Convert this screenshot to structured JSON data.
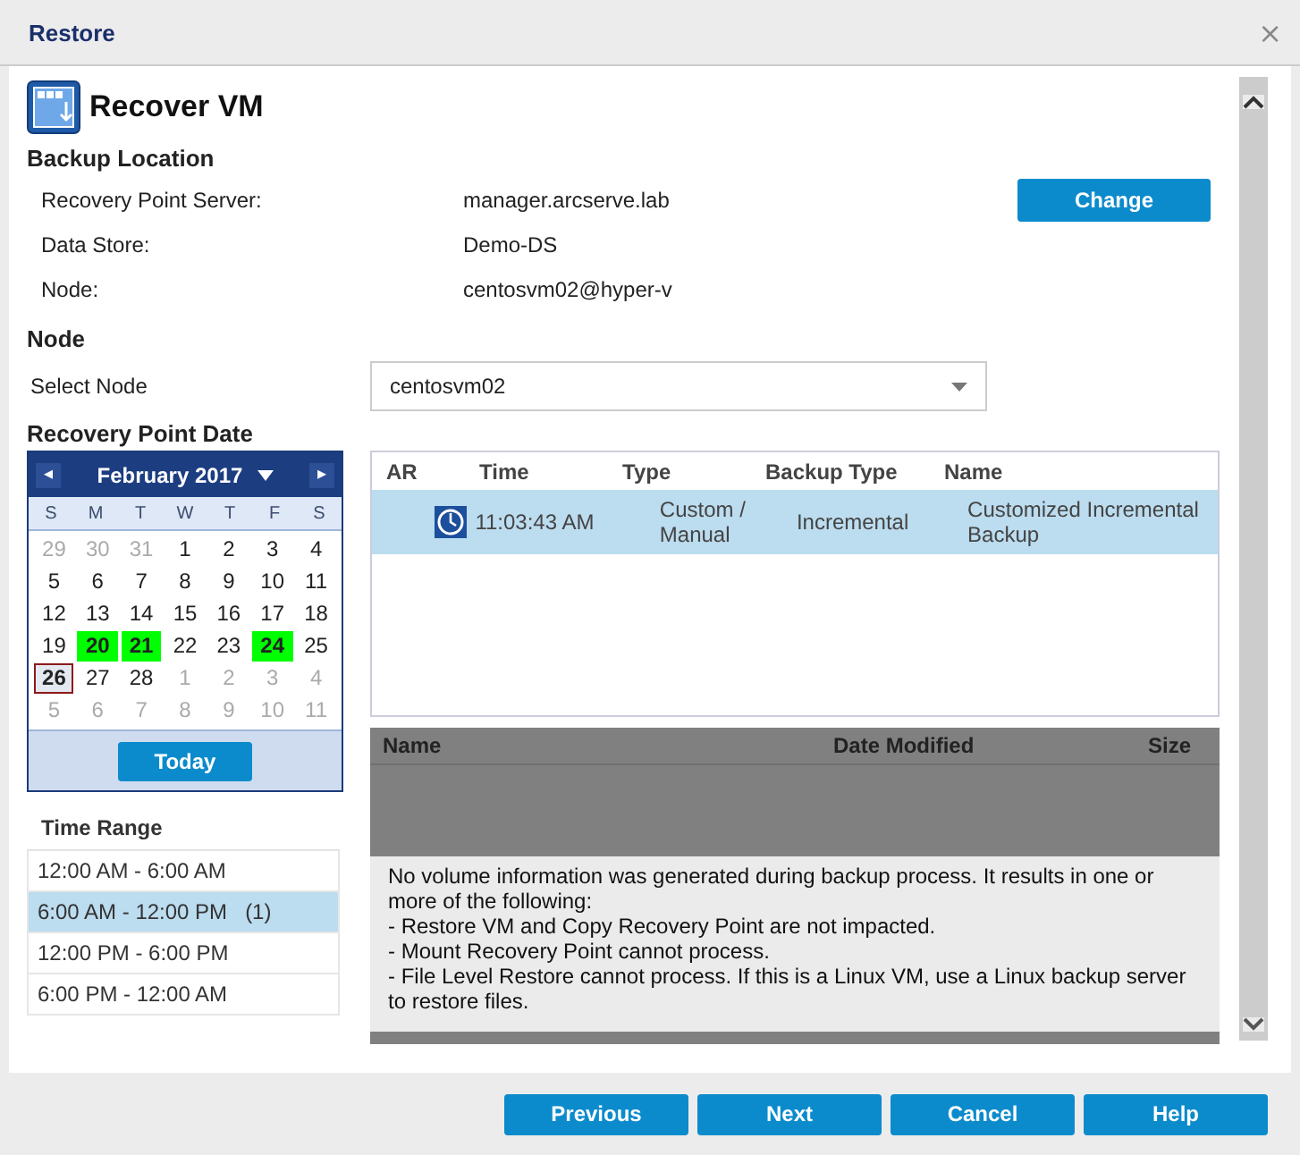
{
  "window": {
    "title": "Restore",
    "close": "×"
  },
  "page_title": "Recover VM",
  "backup_location": {
    "heading": "Backup Location",
    "fields": [
      {
        "label": "Recovery Point Server:",
        "value": "manager.arcserve.lab"
      },
      {
        "label": "Data Store:",
        "value": "Demo-DS"
      },
      {
        "label": "Node:",
        "value": "centosvm02@hyper-v"
      }
    ],
    "change_button": "Change"
  },
  "node": {
    "heading": "Node",
    "label": "Select Node",
    "value": "centosvm02"
  },
  "recovery_point_date": {
    "heading": "Recovery Point Date"
  },
  "calendar": {
    "month": "February 2017",
    "prev": "◂",
    "next": "▸",
    "weekdays": [
      "S",
      "M",
      "T",
      "W",
      "T",
      "F",
      "S"
    ],
    "today_button": "Today",
    "weeks": [
      [
        {
          "day": "29",
          "muted": true,
          "has_backup": false,
          "selected": false
        },
        {
          "day": "30",
          "muted": true,
          "has_backup": false,
          "selected": false
        },
        {
          "day": "31",
          "muted": true,
          "has_backup": false,
          "selected": false
        },
        {
          "day": "1",
          "muted": false,
          "has_backup": false,
          "selected": false
        },
        {
          "day": "2",
          "muted": false,
          "has_backup": false,
          "selected": false
        },
        {
          "day": "3",
          "muted": false,
          "has_backup": false,
          "selected": false
        },
        {
          "day": "4",
          "muted": false,
          "has_backup": false,
          "selected": false
        }
      ],
      [
        {
          "day": "5",
          "muted": false,
          "has_backup": false,
          "selected": false
        },
        {
          "day": "6",
          "muted": false,
          "has_backup": false,
          "selected": false
        },
        {
          "day": "7",
          "muted": false,
          "has_backup": false,
          "selected": false
        },
        {
          "day": "8",
          "muted": false,
          "has_backup": false,
          "selected": false
        },
        {
          "day": "9",
          "muted": false,
          "has_backup": false,
          "selected": false
        },
        {
          "day": "10",
          "muted": false,
          "has_backup": false,
          "selected": false
        },
        {
          "day": "11",
          "muted": false,
          "has_backup": false,
          "selected": false
        }
      ],
      [
        {
          "day": "12",
          "muted": false,
          "has_backup": false,
          "selected": false
        },
        {
          "day": "13",
          "muted": false,
          "has_backup": false,
          "selected": false
        },
        {
          "day": "14",
          "muted": false,
          "has_backup": false,
          "selected": false
        },
        {
          "day": "15",
          "muted": false,
          "has_backup": false,
          "selected": false
        },
        {
          "day": "16",
          "muted": false,
          "has_backup": false,
          "selected": false
        },
        {
          "day": "17",
          "muted": false,
          "has_backup": false,
          "selected": false
        },
        {
          "day": "18",
          "muted": false,
          "has_backup": false,
          "selected": false
        }
      ],
      [
        {
          "day": "19",
          "muted": false,
          "has_backup": false,
          "selected": false
        },
        {
          "day": "20",
          "muted": false,
          "has_backup": true,
          "selected": false
        },
        {
          "day": "21",
          "muted": false,
          "has_backup": true,
          "selected": false
        },
        {
          "day": "22",
          "muted": false,
          "has_backup": false,
          "selected": false
        },
        {
          "day": "23",
          "muted": false,
          "has_backup": false,
          "selected": false
        },
        {
          "day": "24",
          "muted": false,
          "has_backup": true,
          "selected": false
        },
        {
          "day": "25",
          "muted": false,
          "has_backup": false,
          "selected": false
        }
      ],
      [
        {
          "day": "26",
          "muted": false,
          "has_backup": false,
          "selected": true
        },
        {
          "day": "27",
          "muted": false,
          "has_backup": false,
          "selected": false
        },
        {
          "day": "28",
          "muted": false,
          "has_backup": false,
          "selected": false
        },
        {
          "day": "1",
          "muted": true,
          "has_backup": false,
          "selected": false
        },
        {
          "day": "2",
          "muted": true,
          "has_backup": false,
          "selected": false
        },
        {
          "day": "3",
          "muted": true,
          "has_backup": false,
          "selected": false
        },
        {
          "day": "4",
          "muted": true,
          "has_backup": false,
          "selected": false
        }
      ],
      [
        {
          "day": "5",
          "muted": true,
          "has_backup": false,
          "selected": false
        },
        {
          "day": "6",
          "muted": true,
          "has_backup": false,
          "selected": false
        },
        {
          "day": "7",
          "muted": true,
          "has_backup": false,
          "selected": false
        },
        {
          "day": "8",
          "muted": true,
          "has_backup": false,
          "selected": false
        },
        {
          "day": "9",
          "muted": true,
          "has_backup": false,
          "selected": false
        },
        {
          "day": "10",
          "muted": true,
          "has_backup": false,
          "selected": false
        },
        {
          "day": "11",
          "muted": true,
          "has_backup": false,
          "selected": false
        }
      ]
    ]
  },
  "time_range": {
    "heading": "Time Range",
    "items": [
      {
        "label": "12:00 AM - 6:00 AM",
        "selected": false
      },
      {
        "label": "6:00 AM - 12:00 PM",
        "count": "(1)",
        "selected": true
      },
      {
        "label": "12:00 PM - 6:00 PM",
        "selected": false
      },
      {
        "label": "6:00 PM - 12:00 AM",
        "selected": false
      }
    ]
  },
  "recovery_points": {
    "columns": [
      "AR",
      "Time",
      "Type",
      "Backup Type",
      "Name"
    ],
    "rows": [
      {
        "time": "11:03:43 AM",
        "type": "Custom / Manual",
        "backup_type": "Incremental",
        "name": "Customized Incremental Backup",
        "selected": true
      }
    ]
  },
  "files": {
    "columns": [
      "Name",
      "Date Modified",
      "Size"
    ],
    "message": [
      "No volume information was generated during backup process. It results in one or more of the following:",
      "- Restore VM and Copy Recovery Point are not impacted.",
      "- Mount Recovery Point cannot process.",
      "- File Level Restore cannot process. If this is a Linux VM, use a Linux backup server to restore files."
    ]
  },
  "buttons": [
    "Previous",
    "Next",
    "Cancel",
    "Help"
  ]
}
